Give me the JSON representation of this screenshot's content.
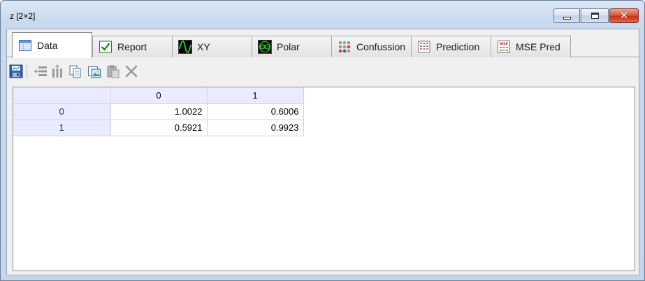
{
  "window": {
    "title": "z [2×2]",
    "controls": {
      "minimize": "minimize",
      "maximize": "maximize",
      "close": "✕"
    }
  },
  "tabs": [
    {
      "label": "Data",
      "icon": "data-table-icon",
      "active": true
    },
    {
      "label": "Report",
      "icon": "report-check-icon",
      "active": false
    },
    {
      "label": "XY",
      "icon": "xy-wave-icon",
      "active": false
    },
    {
      "label": "Polar",
      "icon": "polar-plot-icon",
      "active": false
    },
    {
      "label": "Confussion",
      "icon": "confusion-dots-icon",
      "active": false
    },
    {
      "label": "Prediction",
      "icon": "prediction-grid-icon",
      "active": false
    },
    {
      "label": "MSE Pred",
      "icon": "mse-pred-icon",
      "active": false
    }
  ],
  "toolbar": {
    "icons": [
      "save-icon",
      "insert-row-icon",
      "insert-column-icon",
      "copy-icon",
      "paste-image-icon",
      "paste-icon",
      "delete-icon"
    ]
  },
  "grid": {
    "columns": [
      "0",
      "1"
    ],
    "rows": [
      {
        "label": "0",
        "values": [
          "1.0022",
          "0.6006"
        ]
      },
      {
        "label": "1",
        "values": [
          "0.5921",
          "0.9923"
        ]
      }
    ]
  },
  "colors": {
    "header_bg": "#ebebff",
    "row_header_text": "#1a2a7a",
    "close_button": "#c63217",
    "title_gradient": "#c9d9ee"
  }
}
